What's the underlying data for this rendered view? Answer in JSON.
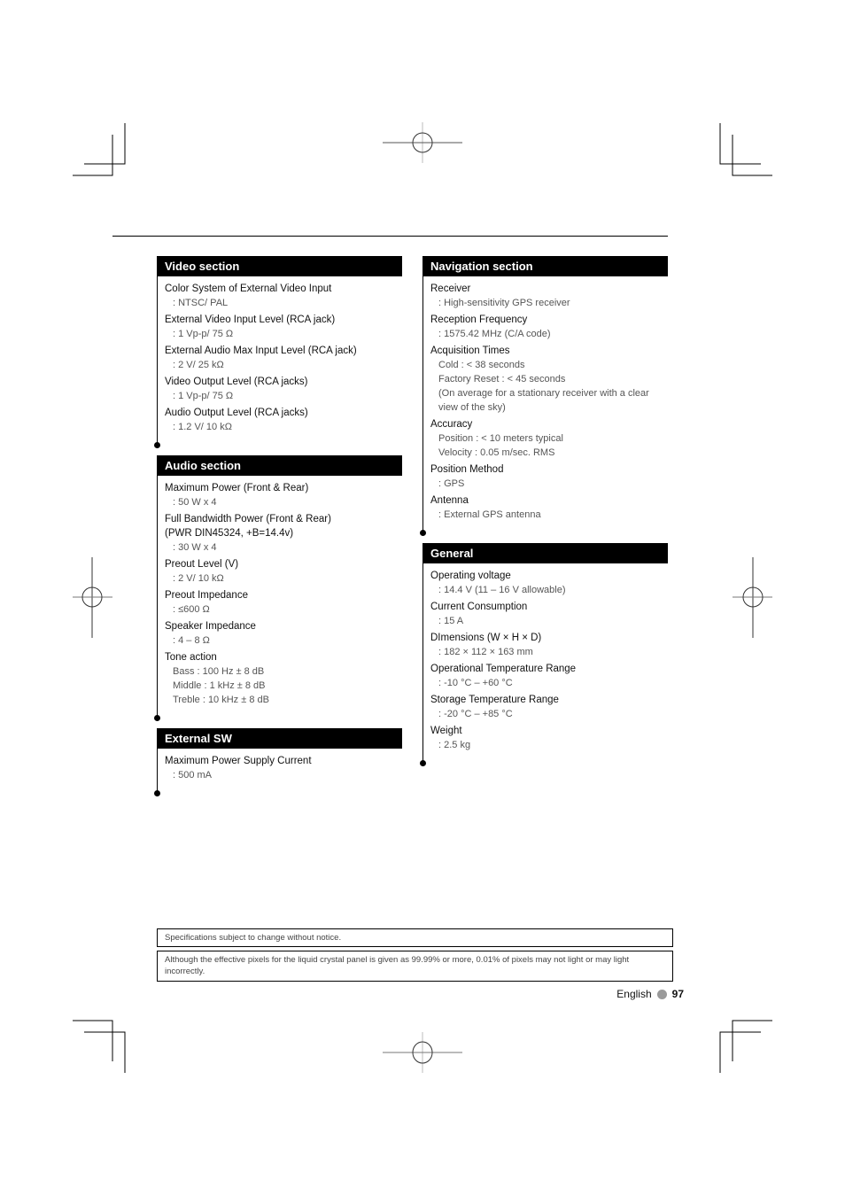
{
  "sections": {
    "video": {
      "title": "Video section",
      "items": [
        {
          "label": "Color System of External Video Input",
          "values": [
            ": NTSC/ PAL"
          ]
        },
        {
          "label": "External Video Input Level (RCA jack)",
          "values": [
            ": 1 Vp-p/ 75 Ω"
          ]
        },
        {
          "label": "External Audio Max Input Level (RCA jack)",
          "values": [
            ": 2 V/ 25 kΩ"
          ]
        },
        {
          "label": "Video Output Level (RCA jacks)",
          "values": [
            ": 1 Vp-p/ 75 Ω"
          ]
        },
        {
          "label": "Audio Output Level (RCA jacks)",
          "values": [
            ": 1.2 V/ 10 kΩ"
          ]
        }
      ]
    },
    "audio": {
      "title": "Audio section",
      "items": [
        {
          "label": "Maximum Power (Front & Rear)",
          "values": [
            ": 50 W x 4"
          ]
        },
        {
          "label": "Full Bandwidth Power (Front & Rear)",
          "label2": "(PWR DIN45324, +B=14.4v)",
          "values": [
            ": 30 W x 4"
          ]
        },
        {
          "label": "Preout Level (V)",
          "values": [
            ": 2 V/ 10 kΩ"
          ]
        },
        {
          "label": "Preout Impedance",
          "values": [
            ": ≤600 Ω"
          ]
        },
        {
          "label": "Speaker Impedance",
          "values": [
            ": 4 – 8 Ω"
          ]
        },
        {
          "label": "Tone action",
          "values": [
            "Bass : 100 Hz ± 8 dB",
            "Middle : 1 kHz ± 8 dB",
            "Treble : 10 kHz ± 8 dB"
          ]
        }
      ]
    },
    "external_sw": {
      "title": "External SW",
      "items": [
        {
          "label": "Maximum Power Supply Current",
          "values": [
            ": 500 mA"
          ]
        }
      ]
    },
    "navigation": {
      "title": "Navigation section",
      "items": [
        {
          "label": "Receiver",
          "values": [
            ": High-sensitivity GPS receiver"
          ]
        },
        {
          "label": "Reception Frequency",
          "values": [
            ": 1575.42 MHz (C/A code)"
          ]
        },
        {
          "label": "Acquisition Times",
          "values": [
            "Cold : < 38 seconds",
            "Factory Reset : < 45 seconds",
            "(On average for a stationary receiver with a clear view of the sky)"
          ]
        },
        {
          "label": "Accuracy",
          "values": [
            "Position : < 10 meters typical",
            "Velocity : 0.05 m/sec. RMS"
          ]
        },
        {
          "label": "Position Method",
          "values": [
            ": GPS"
          ]
        },
        {
          "label": "Antenna",
          "values": [
            ": External GPS antenna"
          ]
        }
      ]
    },
    "general": {
      "title": "General",
      "items": [
        {
          "label": "Operating voltage",
          "values": [
            ": 14.4 V (11 – 16 V allowable)"
          ]
        },
        {
          "label": "Current Consumption",
          "values": [
            ": 15 A"
          ]
        },
        {
          "label": "DImensions  (W × H × D)",
          "values": [
            ": 182 × 112 × 163 mm"
          ]
        },
        {
          "label": "Operational Temperature Range",
          "values": [
            ": -10 °C – +60 °C"
          ]
        },
        {
          "label": "Storage Temperature Range",
          "values": [
            ": -20 °C – +85 °C"
          ]
        },
        {
          "label": "Weight",
          "values": [
            ": 2.5 kg"
          ]
        }
      ]
    }
  },
  "notices": [
    "Specifications subject to change without notice.",
    "Although the effective pixels for the liquid crystal panel is given as 99.99% or more, 0.01% of pixels may not light or may light incorrectly."
  ],
  "footer": {
    "language": "English",
    "page_number": "97"
  }
}
